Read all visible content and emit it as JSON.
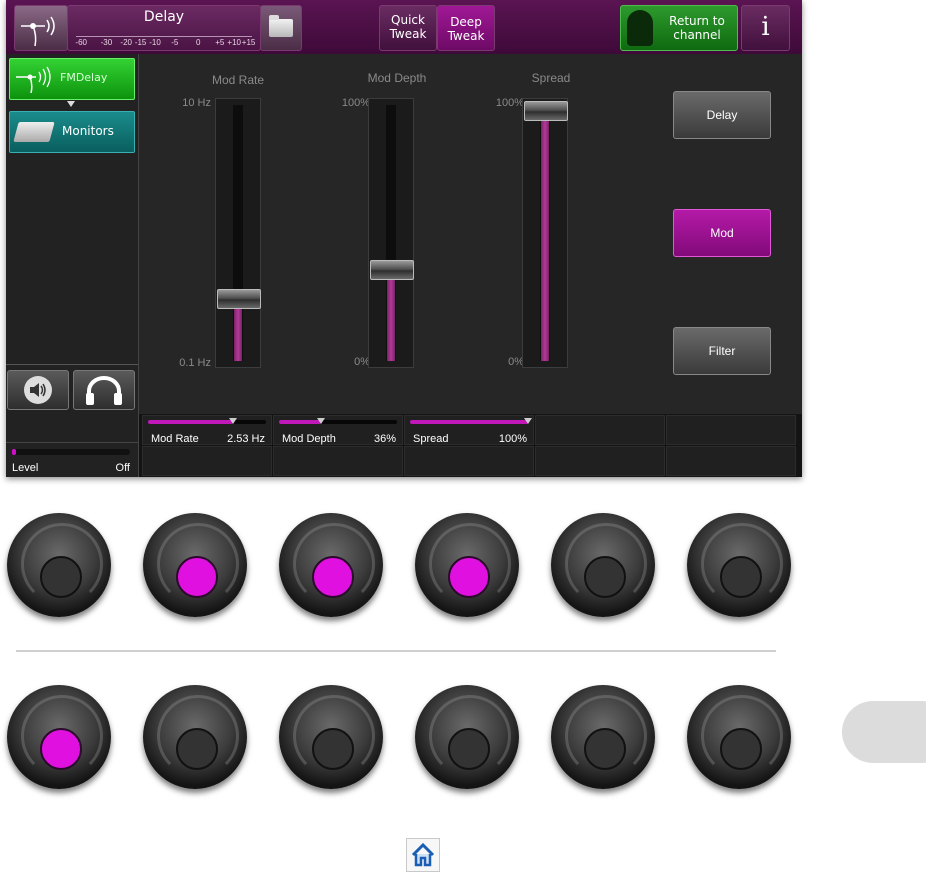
{
  "header": {
    "effect_title": "Delay",
    "meter_scale": [
      "-60",
      "-30",
      "-20",
      "-15",
      "-10",
      "-5",
      "0",
      "+5",
      "+10",
      "+15"
    ],
    "quick_tweak": [
      "Quick",
      "Tweak"
    ],
    "deep_tweak": [
      "Deep",
      "Tweak"
    ],
    "return_to_channel": [
      "Return to",
      "channel"
    ],
    "info": "i"
  },
  "chain": {
    "items": [
      {
        "label": "FMDelay",
        "icon": "fmdelay-wave-icon",
        "active": true
      },
      {
        "label": "Monitors",
        "icon": "monitor-speaker-icon",
        "active": false
      }
    ]
  },
  "sidebar": {
    "speaker_icon": "speaker-icon",
    "headphones_icon": "headphones-icon",
    "level_label": "Level",
    "level_value": "Off"
  },
  "sliders": [
    {
      "title": "Mod Rate",
      "max": "10 Hz",
      "min": "0.1 Hz",
      "fraction": 0.24
    },
    {
      "title": "Mod Depth",
      "max": "100%",
      "min": "0%",
      "fraction": 0.36
    },
    {
      "title": "Spread",
      "max": "100%",
      "min": "0%",
      "fraction": 1.0
    }
  ],
  "side_buttons": [
    {
      "label": "Delay",
      "active": false
    },
    {
      "label": "Mod",
      "active": true
    },
    {
      "label": "Filter",
      "active": false
    }
  ],
  "params": [
    {
      "name": "Mod Rate",
      "value": "2.53 Hz",
      "fraction": 0.72
    },
    {
      "name": "Mod Depth",
      "value": "36%",
      "fraction": 0.36
    },
    {
      "name": "Spread",
      "value": "100%",
      "fraction": 1.0
    }
  ],
  "knobs": {
    "row1": [
      false,
      true,
      true,
      true,
      false,
      false
    ],
    "row2": [
      true,
      false,
      false,
      false,
      false,
      false
    ]
  },
  "colors": {
    "accent_magenta": "#c018b8",
    "active_green": "#1aa81a",
    "monitors_teal": "#117a7a",
    "header_purple": "#4e0f48"
  },
  "footer": {
    "home_icon": "home-icon"
  }
}
